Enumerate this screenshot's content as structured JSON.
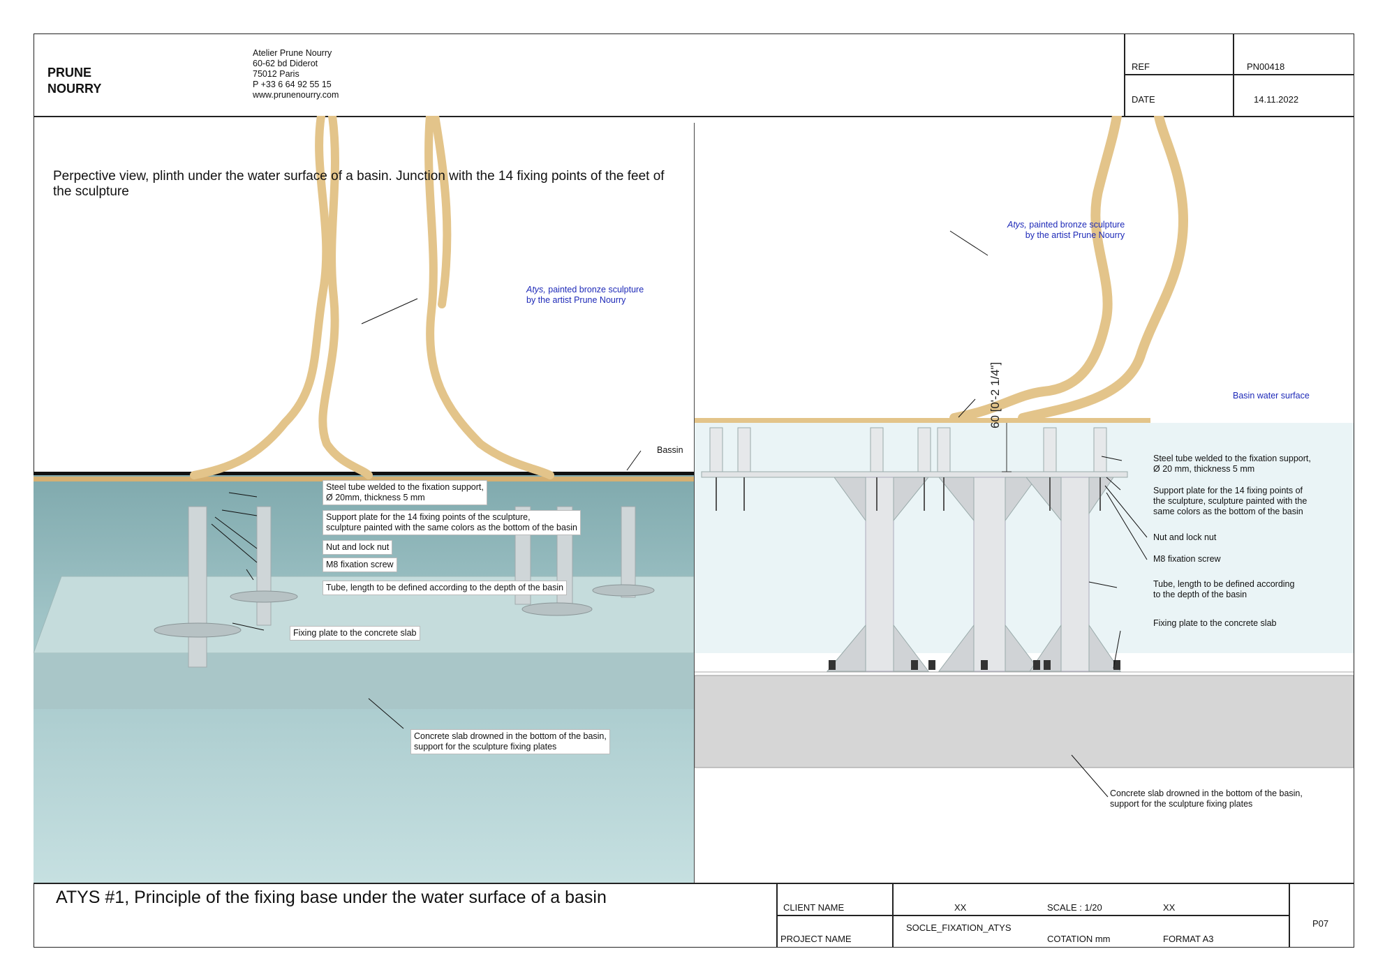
{
  "header": {
    "brand_line1": "PRUNE",
    "brand_line2": "NOURRY",
    "address": [
      "Atelier Prune Nourry",
      "60-62 bd Diderot",
      "75012 Paris",
      "P +33 6 64 92 55 15",
      "www.prunenourry.com"
    ],
    "ref_label": "REF",
    "ref_value": "PN00418",
    "date_label": "DATE",
    "date_value": "14.11.2022"
  },
  "left_view": {
    "title": "Perpective view, plinth under the water surface of a basin. Junction with the 14 fixing points of the feet of the sculpture",
    "sculpture_italic": "Atys,",
    "sculpture_rest": " painted bronze sculpture",
    "sculpture_line2": "by the artist Prune Nourry",
    "bassin": "Bassin",
    "steel_tube": [
      "Steel tube welded to the fixation support,",
      "Ø 20mm, thickness 5 mm"
    ],
    "support_plate": [
      "Support plate for the 14 fixing points of the sculpture,",
      "sculpture painted with the same colors as the bottom of the basin"
    ],
    "nut": "Nut and lock nut",
    "screw": "M8 fixation screw",
    "tube": "Tube, length to be defined according to the depth of the basin",
    "fixing_plate": "Fixing plate to the concrete slab",
    "concrete": [
      "Concrete slab drowned in the bottom of the basin,",
      "support for the sculpture fixing plates"
    ]
  },
  "right_view": {
    "sculpture_italic": "Atys,",
    "sculpture_rest": " painted bronze sculpture",
    "sculpture_line2": "by the artist Prune Nourry",
    "water_surface": "Basin water surface",
    "dimension": "60 [0'-2 1/4\"]",
    "steel_tube": [
      "Steel tube welded to the fixation support,",
      "Ø 20 mm, thickness 5 mm"
    ],
    "support_plate": [
      "Support plate for the 14 fixing points of",
      "the sculpture, sculpture painted with the",
      "same colors as the bottom of the basin"
    ],
    "nut": "Nut and lock nut",
    "screw": "M8 fixation screw",
    "tube": [
      "Tube, length to be defined according",
      "to the depth of the basin"
    ],
    "fixing_plate": "Fixing plate to the concrete slab",
    "concrete": [
      "Concrete slab drowned in the bottom of the basin,",
      "support for the sculpture fixing plates"
    ]
  },
  "title_block": {
    "main_title": "ATYS #1, Principle of the fixing base under the water surface of a basin",
    "client_label": "CLIENT NAME",
    "client_value": "XX",
    "scale_label": "SCALE : 1/20",
    "scale_extra": "XX",
    "project_label": "PROJECT NAME",
    "project_value": "SOCLE_FIXATION_ATYS",
    "cotation_label": "COTATION mm",
    "format_label": "FORMAT A3",
    "page": "P07"
  },
  "colors": {
    "annotation_blue": "#1e2ab8",
    "rope": "#e3c48a",
    "water": "#bcd9db",
    "steel": "#e2e4e6",
    "concrete": "#d6d6d6"
  }
}
